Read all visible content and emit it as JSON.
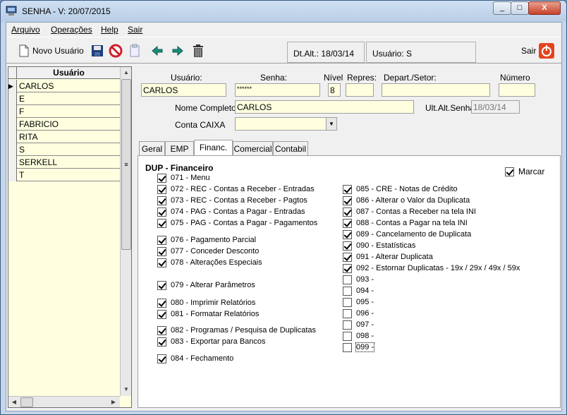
{
  "window": {
    "title": "SENHA - V: 20/07/2015",
    "minimize": "_",
    "maximize": "□",
    "close": "X"
  },
  "menu": [
    "Arquivo",
    "Operações",
    "Help",
    "Sair"
  ],
  "toolbar": {
    "new_user_label": "Novo Usuário",
    "dt_alt_label": "Dt.Alt.:",
    "dt_alt_value": "18/03/14",
    "usuario_label": "Usuário:",
    "usuario_value": "S",
    "exit_label": "Sair"
  },
  "user_grid": {
    "header": "Usuário",
    "rows": [
      "CARLOS",
      "E",
      "F",
      "FABRICIO",
      "RITA",
      "S",
      "SERKELL",
      "T"
    ],
    "current_index": 0
  },
  "form": {
    "usuario_label": "Usuário:",
    "usuario_value": "CARLOS",
    "senha_label": "Senha:",
    "senha_value": "******",
    "nivel_label": "Nível",
    "nivel_value": "8",
    "repres_label": "Repres:",
    "repres_value": "",
    "depart_label": "Depart./Setor:",
    "depart_value": "",
    "numero_label": "Número",
    "numero_value": "",
    "nome_label": "Nome Completo",
    "nome_value": "CARLOS",
    "ult_alt_label": "Ult.Alt.Senha",
    "ult_alt_value": "18/03/14",
    "conta_label": "Conta CAIXA",
    "conta_value": ""
  },
  "tabs": [
    "Geral",
    "EMP",
    "Financ.",
    "Comercial",
    "Contabil"
  ],
  "active_tab": "Financ.",
  "financ": {
    "section_title": "DUP - Financeiro",
    "marcar_label": "Marcar",
    "marcar_checked": true,
    "left_items": [
      {
        "label": "071 - Menu",
        "checked": true
      },
      {
        "label": "072 - REC - Contas a Receber - Entradas",
        "checked": true
      },
      {
        "label": "073 - REC - Contas a Receber - Pagtos",
        "checked": true
      },
      {
        "label": "074 - PAG - Contas a Pagar - Entradas",
        "checked": true
      },
      {
        "label": "075 - PAG - Contas a Pagar - Pagamentos",
        "checked": true
      },
      {
        "label": "076 - Pagamento Parcial",
        "checked": true
      },
      {
        "label": "077 - Conceder Desconto",
        "checked": true
      },
      {
        "label": "078 - Alterações Especiais",
        "checked": true
      },
      {
        "label": "079 - Alterar Parâmetros",
        "checked": true
      },
      {
        "label": "080 - Imprimir Relatórios",
        "checked": true
      },
      {
        "label": "081 - Formatar Relatórios",
        "checked": true
      },
      {
        "label": "082 - Programas / Pesquisa de Duplicatas",
        "checked": true
      },
      {
        "label": "083 - Exportar para Bancos",
        "checked": true
      },
      {
        "label": "084 - Fechamento",
        "checked": true
      }
    ],
    "right_items": [
      {
        "label": "085 - CRE - Notas de Crédito",
        "checked": true
      },
      {
        "label": "086 - Alterar o Valor da Duplicata",
        "checked": true
      },
      {
        "label": "087 - Contas a Receber na tela INI",
        "checked": true
      },
      {
        "label": "088 - Contas a Pagar na tela INI",
        "checked": true
      },
      {
        "label": "089 - Cancelamento de Duplicata",
        "checked": true
      },
      {
        "label": "090 - Estatísticas",
        "checked": true
      },
      {
        "label": "091 - Alterar Duplicata",
        "checked": true
      },
      {
        "label": "092 - Estornar Duplicatas - 19x / 29x / 49x / 59x",
        "checked": true
      },
      {
        "label": "093 -",
        "checked": false
      },
      {
        "label": "094 -",
        "checked": false
      },
      {
        "label": "095 -",
        "checked": false
      },
      {
        "label": "096 -",
        "checked": false
      },
      {
        "label": "097 -",
        "checked": false
      },
      {
        "label": "098 -",
        "checked": false
      },
      {
        "label": "099 -",
        "checked": false
      }
    ]
  }
}
